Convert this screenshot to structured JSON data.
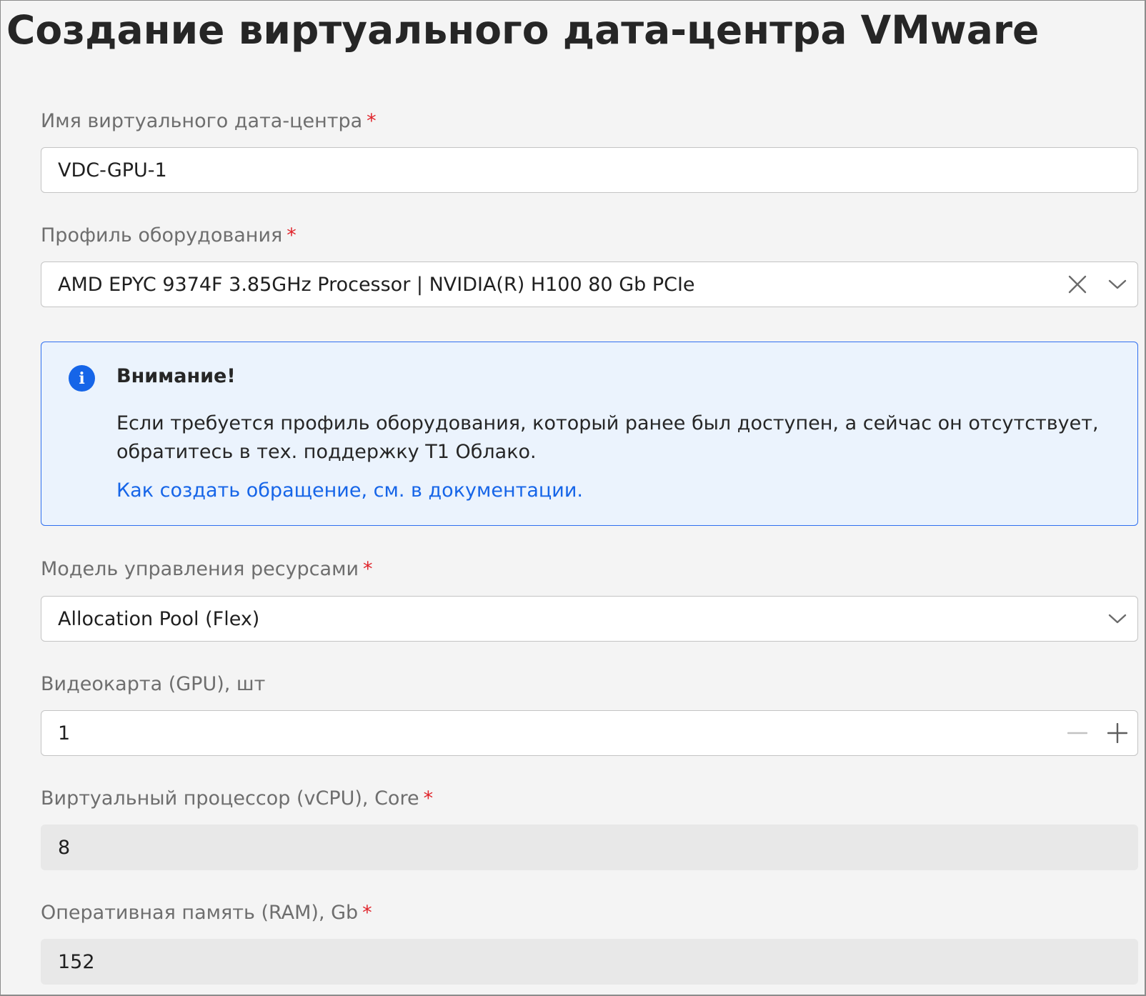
{
  "title": "Создание виртуального дата-центра VMware",
  "required_mark": "*",
  "fields": {
    "vdc_name": {
      "label": "Имя виртуального дата-центра",
      "value": "VDC-GPU-1"
    },
    "hardware_profile": {
      "label": "Профиль оборудования",
      "value": "AMD EPYC 9374F 3.85GHz Processor | NVIDIA(R) H100 80 Gb PCIe",
      "icons": [
        "close-icon",
        "chevron-down-icon"
      ]
    },
    "resource_model": {
      "label": "Модель управления ресурсами",
      "value": "Allocation Pool (Flex)",
      "icons": [
        "chevron-down-icon"
      ]
    },
    "gpu": {
      "label": "Видеокарта (GPU), шт",
      "value": "1",
      "icons": [
        "minus-icon",
        "plus-icon"
      ]
    },
    "vcpu": {
      "label": "Виртуальный процессор (vCPU), Core",
      "value": "8"
    },
    "ram": {
      "label": "Оперативная память (RAM), Gb",
      "value": "152"
    }
  },
  "alert": {
    "icon": "info-icon",
    "icon_glyph": "i",
    "title": "Внимание!",
    "text": "Если требуется профиль оборудования, который ранее был доступен, а сейчас он отсутствует, обратитесь в тех. поддержку Т1 Облако.",
    "link": "Как создать обращение, см. в документации."
  },
  "colors": {
    "background": "#f4f4f4",
    "required": "#e0242b",
    "accent": "#1665e8",
    "alert_bg": "#ebf3fd",
    "alert_border": "#2f6ff0",
    "readonly_bg": "#e8e8e8"
  }
}
